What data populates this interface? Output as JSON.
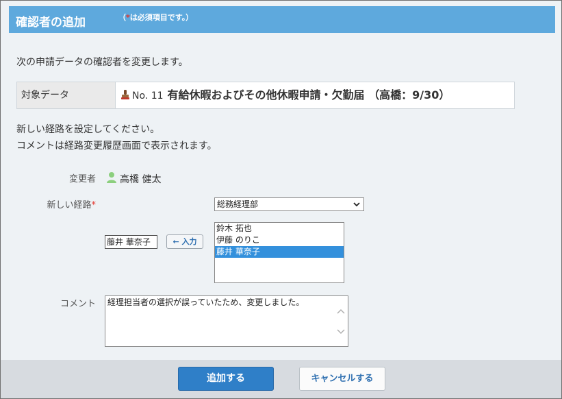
{
  "header": {
    "title": "確認者の追加",
    "req_star": "*",
    "req_note": "は必須項目です。）",
    "req_open": "（"
  },
  "intro": "次の申請データの確認者を変更します。",
  "target": {
    "label": "対象データ",
    "number": "No. 11",
    "name": "有給休暇およびその他休暇申請・欠勤届 （高橋：9/30）"
  },
  "instructions": [
    "新しい経路を設定してください。",
    "コメントは経路変更履歴画面で表示されます。"
  ],
  "changer": {
    "label": "変更者",
    "name": "高橋 健太"
  },
  "route": {
    "label": "新しい経路",
    "required_mark": "*",
    "group_select": "総務経理部",
    "selected_input": "藤井 華奈子",
    "input_button": "← 入力",
    "options": [
      "鈴木 拓也",
      "伊藤 のりこ",
      "藤井 華奈子"
    ],
    "selected_index": 2
  },
  "comment": {
    "label": "コメント",
    "value": "経理担当者の選択が誤っていたため、変更しました。"
  },
  "buttons": {
    "add": "追加する",
    "cancel": "キャンセルする"
  },
  "colors": {
    "header_bg": "#5ea9dd",
    "primary": "#2f7fc8",
    "required": "#e4332a",
    "selection": "#3390dc"
  }
}
